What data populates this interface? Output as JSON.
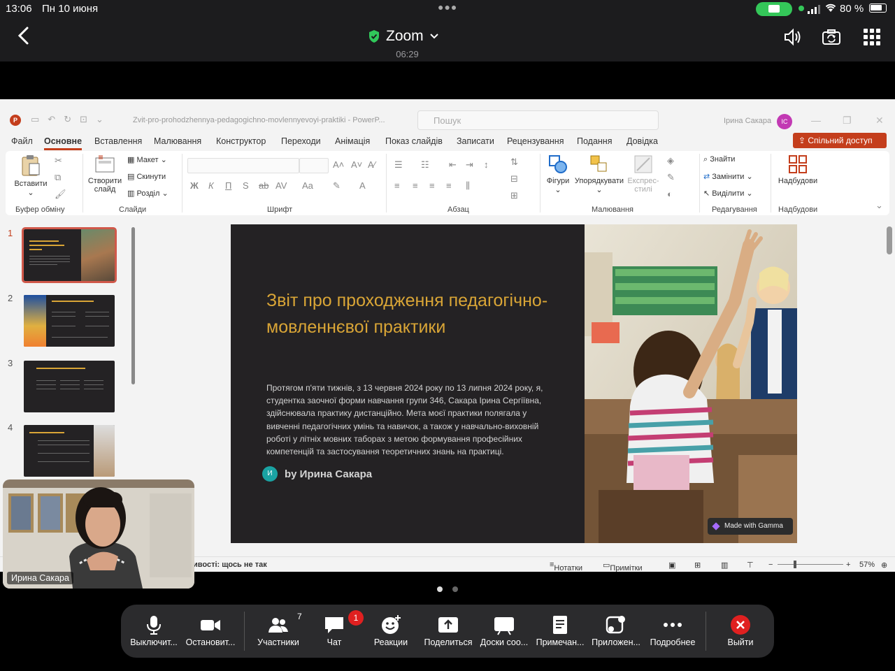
{
  "status_bar": {
    "time": "13:06",
    "date": "Пн 10 июня",
    "battery": "80 %",
    "battery_level": 0.8
  },
  "zoom": {
    "title": "Zoom",
    "timer": "06:29"
  },
  "powerpoint": {
    "doc_name": "Zvit-pro-prohodzhennya-pedagogichno-movlennyevoyi-praktiki  -  PowerP...",
    "search_placeholder": "Пошук",
    "user_name": "Ірина Сакара",
    "user_initials": "IC",
    "tabs": [
      "Файл",
      "Основне",
      "Вставлення",
      "Малювання",
      "Конструктор",
      "Переходи",
      "Анімація",
      "Показ слайдів",
      "Записати",
      "Рецензування",
      "Подання",
      "Довідка"
    ],
    "active_tab": "Основне",
    "share_label": "Спільний доступ",
    "ribbon": {
      "paste": "Вставити",
      "new_slide_1": "Створити",
      "new_slide_2": "слайд",
      "layout": "Макет",
      "reset": "Скинути",
      "section": "Розділ",
      "shapes": "Фігури",
      "arrange": "Упорядкувати",
      "quick_styles_1": "Експрес-",
      "quick_styles_2": "стилі",
      "find": "Знайти",
      "replace": "Замінити",
      "select": "Виділити",
      "addins": "Надбудови",
      "groups": {
        "clipboard": "Буфер обміну",
        "slides": "Слайди",
        "font": "Шрифт",
        "paragraph": "Абзац",
        "drawing": "Малювання",
        "editing": "Редагування",
        "addins": "Надбудови"
      }
    },
    "slides": [
      {
        "num": "1"
      },
      {
        "num": "2"
      },
      {
        "num": "3"
      },
      {
        "num": "4"
      }
    ],
    "status": {
      "feedback": "ивості: щось не так",
      "notes": "Нотатки",
      "comments": "Примітки",
      "zoom": "57%"
    }
  },
  "slide": {
    "title": "Звіт про проходження педагогічно-мовленнєвої практики",
    "body": "Протягом п'яти тижнів, з 13 червня 2024 року по 13 липня 2024 року, я, студентка заочної форми навчання групи 346, Сакара Ірина Сергіївна, здійснювала практику дистанційно. Мета моєї практики полягала у вивченні педагогічних умінь та навичок, а також у навчально-виховній роботі у літніх мовних таборах з метою формування професійних компетенцій та застосування теоретичних знань на практиці.",
    "author": "by Ирина Сакара",
    "author_initial": "И",
    "badge": "Made with Gamma"
  },
  "pip": {
    "name": "Ирина Сакара"
  },
  "toolbar": {
    "mute": "Выключит...",
    "video": "Остановит...",
    "participants": "Участники",
    "participants_count": "7",
    "chat": "Чат",
    "chat_badge": "1",
    "reactions": "Реакции",
    "share": "Поделиться",
    "whiteboards": "Доски соо...",
    "notes": "Примечан...",
    "apps": "Приложен...",
    "more": "Подробнее",
    "leave": "Выйти"
  },
  "colors": {
    "accent_ppt": "#c43e1c",
    "slide_title": "#d9a536",
    "slide_bg": "#242224",
    "leave": "#e02020",
    "status_green": "#34c759"
  }
}
